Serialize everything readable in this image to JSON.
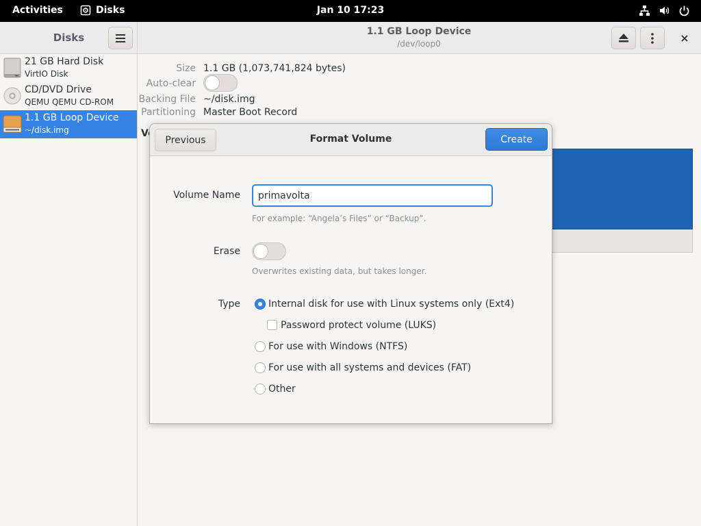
{
  "topbar": {
    "activities": "Activities",
    "app_name": "Disks",
    "clock": "Jan 10  17:23",
    "tray_icons": [
      "network-icon",
      "volume-icon",
      "power-icon"
    ]
  },
  "sidebar": {
    "title": "Disks",
    "items": [
      {
        "name": "21 GB Hard Disk",
        "sub": "VirtIO Disk",
        "icon": "harddisk-icon"
      },
      {
        "name": "CD/DVD Drive",
        "sub": "QEMU QEMU CD-ROM",
        "icon": "optical-drive-icon"
      },
      {
        "name": "1.1 GB Loop Device",
        "sub": "~/disk.img",
        "icon": "loop-device-icon",
        "selected": true
      }
    ]
  },
  "header": {
    "title": "1.1 GB Loop Device",
    "subtitle": "/dev/loop0"
  },
  "properties": {
    "size_label": "Size",
    "size_value": "1.1 GB (1,073,741,824 bytes)",
    "autoclear_label": "Auto-clear",
    "backing_label": "Backing File",
    "backing_value": "~/disk.img",
    "partitioning_label": "Partitioning",
    "partitioning_value": "Master Boot Record",
    "volumes_heading": "Vo"
  },
  "dialog": {
    "title": "Format Volume",
    "previous_label": "Previous",
    "create_label": "Create",
    "volume_name_label": "Volume Name",
    "volume_name_value": "primavolta",
    "volume_name_hint": "For example: “Angela’s Files” or “Backup”.",
    "erase_label": "Erase",
    "erase_hint": "Overwrites existing data, but takes longer.",
    "type_label": "Type",
    "type_options": [
      {
        "label": "Internal disk for use with Linux systems only (Ext4)",
        "checked": true
      },
      {
        "label": "For use with Windows (NTFS)",
        "checked": false
      },
      {
        "label": "For use with all systems and devices (FAT)",
        "checked": false
      },
      {
        "label": "Other",
        "checked": false
      }
    ],
    "luks_label": "Password protect volume (LUKS)"
  },
  "colors": {
    "accent": "#3584e4",
    "volume_bar": "#1e64b4",
    "topbar": "#000000"
  }
}
